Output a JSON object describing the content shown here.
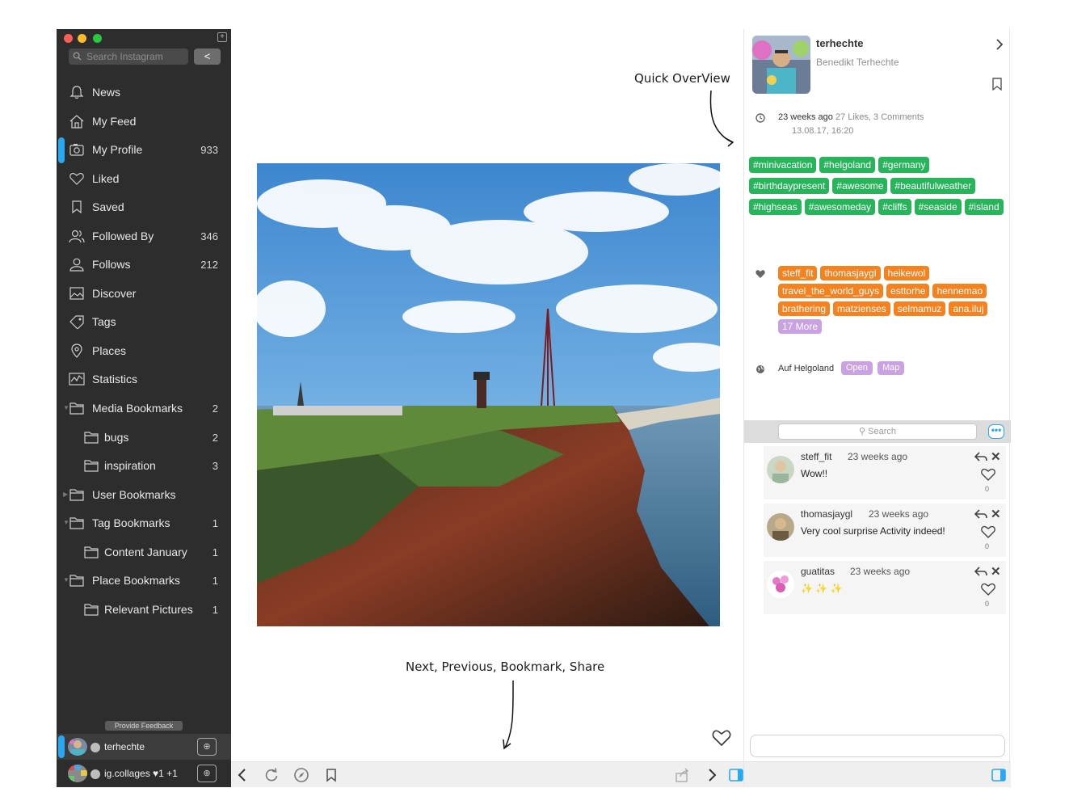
{
  "sidebar": {
    "search_placeholder": "Search Instagram",
    "collapse_glyph": "<",
    "new_window_glyph": "+",
    "items": [
      {
        "label": "News",
        "count": "",
        "icon": "bell-icon"
      },
      {
        "label": "My Feed",
        "count": "",
        "icon": "home-icon"
      },
      {
        "label": "My Profile",
        "count": "933",
        "icon": "camera-icon"
      },
      {
        "label": "Liked",
        "count": "",
        "icon": "heart-icon"
      },
      {
        "label": "Saved",
        "count": "",
        "icon": "bookmark-icon"
      },
      {
        "label": "Followed By",
        "count": "346",
        "icon": "users-icon"
      },
      {
        "label": "Follows",
        "count": "212",
        "icon": "user-icon"
      },
      {
        "label": "Discover",
        "count": "",
        "icon": "image-icon"
      },
      {
        "label": "Tags",
        "count": "",
        "icon": "tag-icon"
      },
      {
        "label": "Places",
        "count": "",
        "icon": "pin-icon"
      },
      {
        "label": "Statistics",
        "count": "",
        "icon": "chart-icon"
      },
      {
        "label": "Media Bookmarks",
        "count": "2",
        "icon": "folder-icon"
      },
      {
        "label": "bugs",
        "count": "2",
        "icon": "folder-icon"
      },
      {
        "label": "inspiration",
        "count": "3",
        "icon": "folder-icon"
      },
      {
        "label": "User Bookmarks",
        "count": "",
        "icon": "folder-icon"
      },
      {
        "label": "Tag Bookmarks",
        "count": "1",
        "icon": "folder-icon"
      },
      {
        "label": "Content January",
        "count": "1",
        "icon": "folder-icon"
      },
      {
        "label": "Place Bookmarks",
        "count": "1",
        "icon": "folder-icon"
      },
      {
        "label": "Relevant Pictures",
        "count": "1",
        "icon": "folder-icon"
      }
    ],
    "feedback_label": "Provide Feedback",
    "accounts": [
      {
        "name": "terhechte",
        "active": true
      },
      {
        "name": "ig.collages ♥1 +1",
        "active": false
      }
    ]
  },
  "annotations": {
    "quick_overview": "Quick OverView",
    "nav_actions": "Next, Previous, Bookmark, Share"
  },
  "post": {
    "username": "terhechte",
    "full_name": "Benedikt Terhechte",
    "time_ago": "23 weeks ago",
    "stats": "27 Likes, 3 Comments",
    "date": "13.08.17, 16:20",
    "hashtags": [
      "#minivacation",
      "#helgoland",
      "#germany",
      "#birthdaypresent",
      "#awesome",
      "#beautifulweather",
      "#highseas",
      "#awesomeday",
      "#cliffs",
      "#seaside",
      "#island"
    ],
    "likers": [
      "steff_fit",
      "thomasjaygl",
      "heikewol",
      "travel_the_world_guys",
      "esttorhe",
      "hennemao",
      "brathering",
      "matzienses",
      "selmamuz",
      "ana.iluj"
    ],
    "more_likes": "17 More",
    "place": "Auf Helgoland",
    "place_open": "Open",
    "place_map": "Map"
  },
  "comments": {
    "search_placeholder": "Search",
    "more_glyph": "•••",
    "items": [
      {
        "user": "steff_fit",
        "time": "23 weeks ago",
        "text": "Wow!!",
        "likes": "0"
      },
      {
        "user": "thomasjaygl",
        "time": "23 weeks ago",
        "text": "Very cool surprise Activity indeed!",
        "likes": "0"
      },
      {
        "user": "guatitas",
        "time": "23 weeks ago",
        "text": "✨ ✨ ✨",
        "likes": "0"
      }
    ]
  },
  "colors": {
    "sidebar_bg": "#2d2d2e",
    "accent_blue": "#28a8f2",
    "hashtag_green": "#27b45b",
    "liker_orange": "#f6821f",
    "place_purple": "#caa1e3"
  }
}
